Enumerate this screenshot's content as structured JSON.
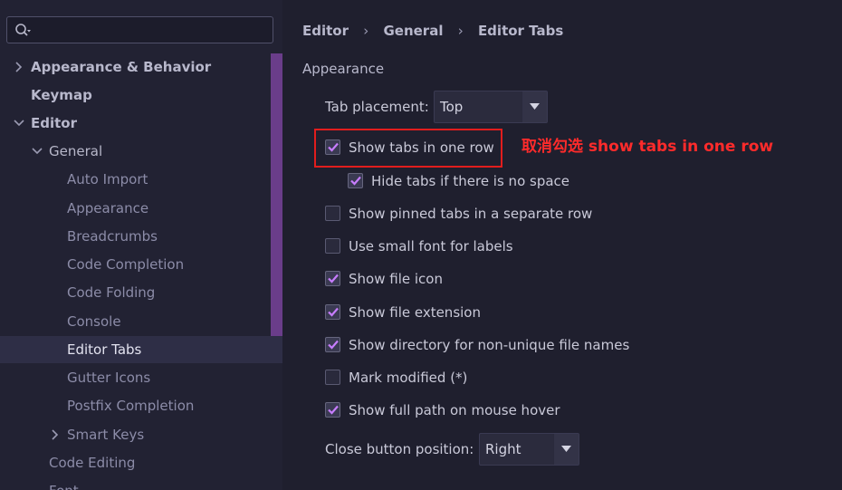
{
  "search": {
    "value": "",
    "placeholder": ""
  },
  "tree": [
    {
      "label": "Appearance & Behavior",
      "arrow": "›",
      "bold": true
    },
    {
      "label": "Keymap",
      "arrow": "",
      "bold": true
    },
    {
      "label": "Editor",
      "arrow": "⌄",
      "bold": true
    },
    {
      "label": "General",
      "arrow": "⌄",
      "bold": false
    },
    {
      "label": "Auto Import",
      "arrow": ""
    },
    {
      "label": "Appearance",
      "arrow": ""
    },
    {
      "label": "Breadcrumbs",
      "arrow": ""
    },
    {
      "label": "Code Completion",
      "arrow": ""
    },
    {
      "label": "Code Folding",
      "arrow": ""
    },
    {
      "label": "Console",
      "arrow": ""
    },
    {
      "label": "Editor Tabs",
      "arrow": "",
      "selected": true
    },
    {
      "label": "Gutter Icons",
      "arrow": ""
    },
    {
      "label": "Postfix Completion",
      "arrow": ""
    },
    {
      "label": "Smart Keys",
      "arrow": "›"
    },
    {
      "label": "Code Editing",
      "arrow": ""
    },
    {
      "label": "Font",
      "arrow": ""
    }
  ],
  "breadcrumb": [
    "Editor",
    "General",
    "Editor Tabs"
  ],
  "section_title": "Appearance",
  "tab_placement": {
    "label": "Tab placement:",
    "value": "Top"
  },
  "options": [
    {
      "label": "Show tabs in one row",
      "checked": true
    },
    {
      "label": "Hide tabs if there is no space",
      "checked": true
    },
    {
      "label": "Show pinned tabs in a separate row",
      "checked": false
    },
    {
      "label": "Use small font for labels",
      "checked": false
    },
    {
      "label": "Show file icon",
      "checked": true
    },
    {
      "label": "Show file extension",
      "checked": true
    },
    {
      "label": "Show directory for non-unique file names",
      "checked": true
    },
    {
      "label": "Mark modified (*)",
      "checked": false
    },
    {
      "label": "Show full path on mouse hover",
      "checked": true
    }
  ],
  "close_button": {
    "label": "Close button position:",
    "value": "Right"
  },
  "annotation": "取消勾选 show tabs in one row",
  "colors": {
    "accent": "#6a3d8a",
    "check": "#c77dff",
    "annotation": "#ff2b2b",
    "highlight_box": "#e11d1d"
  }
}
